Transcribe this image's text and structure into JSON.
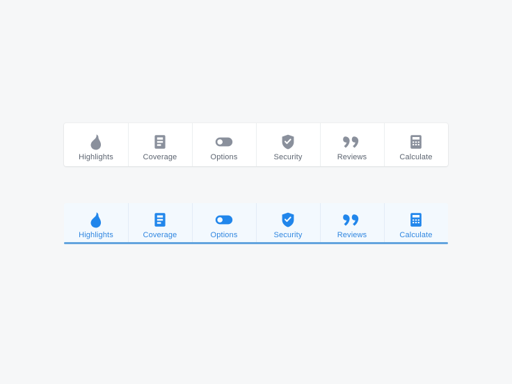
{
  "colors": {
    "page_background": "#f6f7f8",
    "card_background": "#ffffff",
    "active_card_background": "#f3f9fe",
    "inactive_icon": "#8a909c",
    "inactive_label": "#5c6470",
    "active_icon": "#2186eb",
    "active_label": "#2f86e0",
    "active_underline": "#63a4de",
    "divider": "#eceef0"
  },
  "tab_sets": [
    {
      "name": "default-state",
      "state": "inactive",
      "tabs": [
        {
          "icon": "flame-icon",
          "label": "Highlights"
        },
        {
          "icon": "document-lines-icon",
          "label": "Coverage"
        },
        {
          "icon": "toggle-switch-icon",
          "label": "Options"
        },
        {
          "icon": "shield-check-icon",
          "label": "Security"
        },
        {
          "icon": "quote-marks-icon",
          "label": "Reviews"
        },
        {
          "icon": "calculator-icon",
          "label": "Calculate"
        }
      ]
    },
    {
      "name": "active-state",
      "state": "active",
      "tabs": [
        {
          "icon": "flame-icon",
          "label": "Highlights"
        },
        {
          "icon": "document-lines-icon",
          "label": "Coverage"
        },
        {
          "icon": "toggle-switch-icon",
          "label": "Options"
        },
        {
          "icon": "shield-check-icon",
          "label": "Security"
        },
        {
          "icon": "quote-marks-icon",
          "label": "Reviews"
        },
        {
          "icon": "calculator-icon",
          "label": "Calculate"
        }
      ]
    }
  ]
}
